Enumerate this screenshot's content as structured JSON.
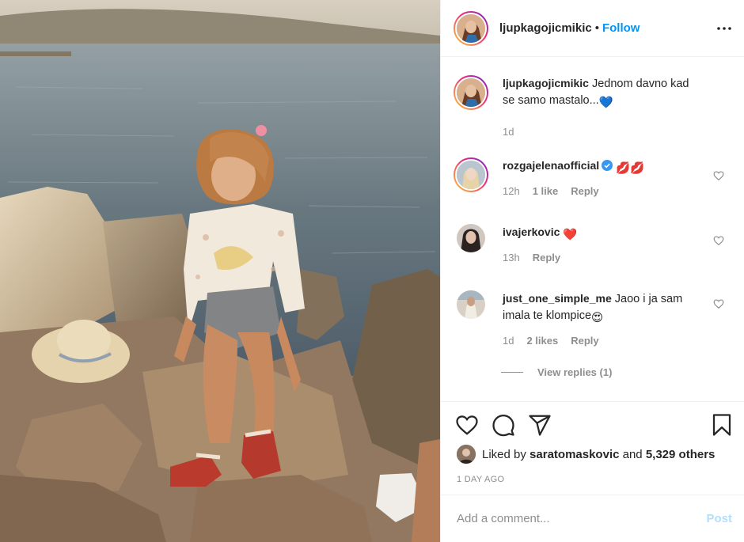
{
  "header": {
    "username": "ljupkagojicmikic",
    "separator": "•",
    "follow_label": "Follow",
    "more_icon": "more-horizontal-icon"
  },
  "caption": {
    "username": "ljupkagojicmikic",
    "text": "Jednom davno kad se samo mastalo...",
    "emoji": "💙",
    "time": "1d"
  },
  "comments": [
    {
      "username": "rozgajelenaofficial",
      "verified": true,
      "text": "",
      "emoji": "💋💋",
      "time": "12h",
      "likes": "1 like",
      "reply_label": "Reply"
    },
    {
      "username": "ivajerkovic",
      "verified": false,
      "text": "",
      "emoji": "❤️",
      "time": "13h",
      "likes": "",
      "reply_label": "Reply"
    },
    {
      "username": "just_one_simple_me",
      "verified": false,
      "text": "Jaoo i ja sam imala te klompice",
      "emoji": "😍",
      "time": "1d",
      "likes": "2 likes",
      "reply_label": "Reply"
    }
  ],
  "view_replies": "View replies (1)",
  "likes": {
    "prefix": "Liked by",
    "user": "saratomaskovic",
    "conj": "and",
    "others": "5,329 others"
  },
  "date": "1 DAY AGO",
  "add_comment": {
    "placeholder": "Add a comment...",
    "post_label": "Post"
  },
  "colors": {
    "link_blue": "#0095f6",
    "post_disabled": "#b2dffc",
    "muted": "#8e8e8e",
    "like_red": "#ed4956"
  }
}
